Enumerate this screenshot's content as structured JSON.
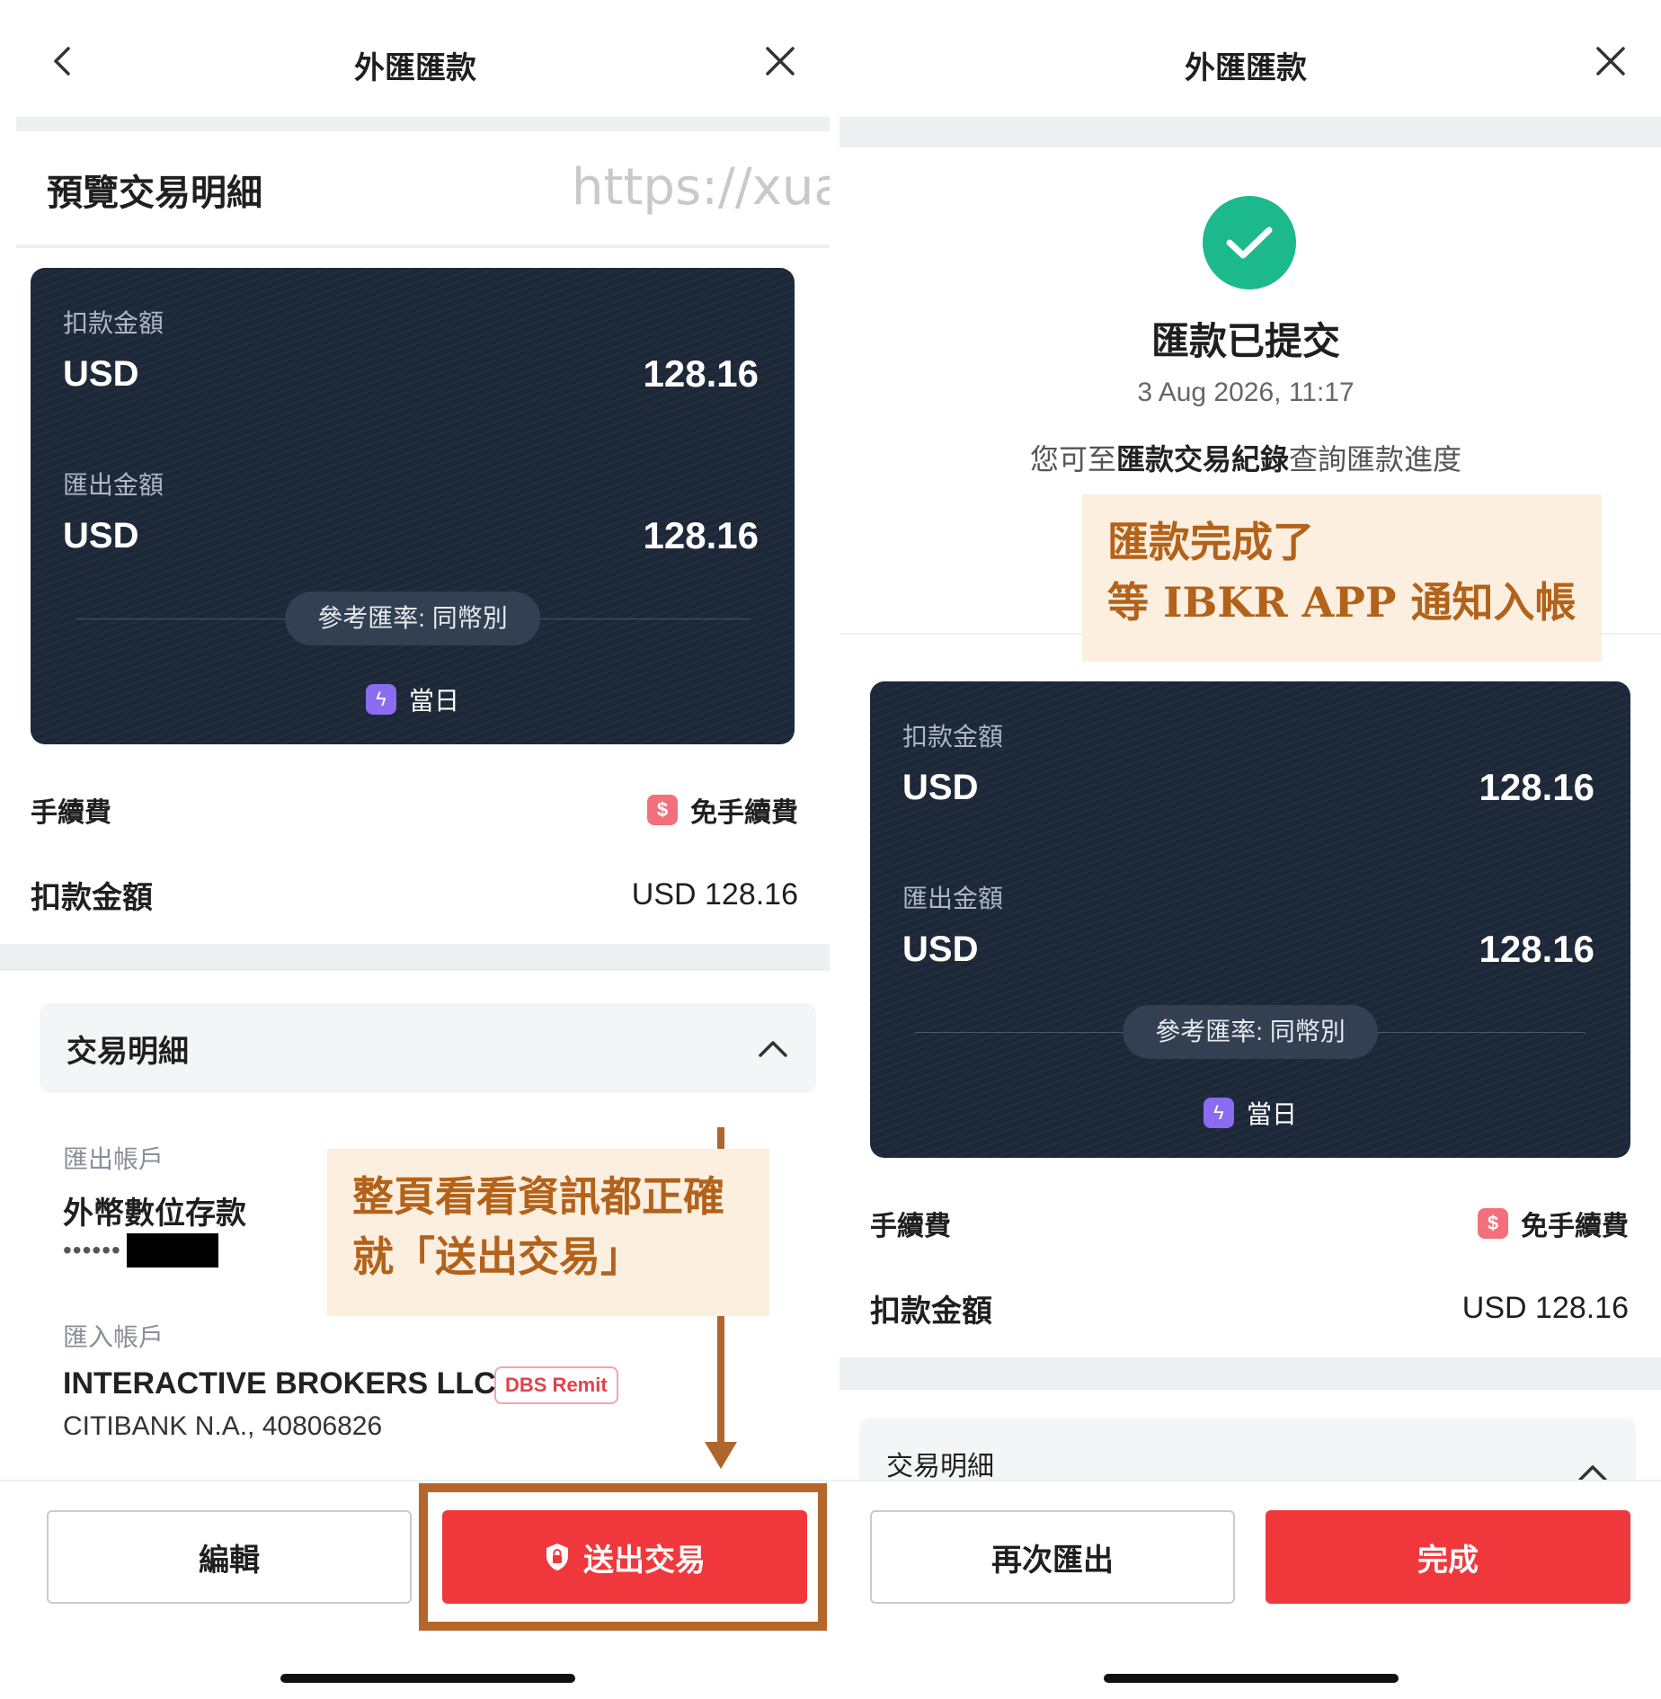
{
  "left": {
    "nav_title": "外匯匯款",
    "preview_title": "預覽交易明細",
    "watermark": "https://xuanstyl.com/",
    "card": {
      "debit_label": "扣款金額",
      "debit_currency": "USD",
      "debit_amount": "128.16",
      "remit_label": "匯出金額",
      "remit_currency": "USD",
      "remit_amount": "128.16",
      "rate_text": "參考匯率: 同幣別",
      "speed_icon": "lightning-icon",
      "speed_text": "當日"
    },
    "fee_label": "手續費",
    "fee_icon": "dollar-badge-icon",
    "fee_value": "免手續費",
    "debit_row_label": "扣款金額",
    "debit_row_value": "USD 128.16",
    "details_header": "交易明細",
    "from_label": "匯出帳戶",
    "from_name": "外幣數位存款",
    "from_masked": "••••••",
    "to_label": "匯入帳戶",
    "to_name": "INTERACTIVE BROKERS LLC",
    "to_tag": "DBS Remit",
    "to_bank": "CITIBANK N.A., 40806826",
    "note_line1": "整頁看看資訊都正確",
    "note_line2": "就「送出交易」",
    "edit_button": "編輯",
    "submit_button": "送出交易",
    "submit_icon": "lock-shield-icon"
  },
  "right": {
    "nav_title": "外匯匯款",
    "success_icon": "check-icon",
    "done_title": "匯款已提交",
    "done_time": "3 Aug 2026, 11:17",
    "hint_prefix": "您可至",
    "hint_link": "匯款交易紀錄",
    "hint_suffix": "查詢匯款進度",
    "note_line1": "匯款完成了",
    "note_line2": "等 IBKR APP 通知入帳",
    "card": {
      "debit_label": "扣款金額",
      "debit_currency": "USD",
      "debit_amount": "128.16",
      "remit_label": "匯出金額",
      "remit_currency": "USD",
      "remit_amount": "128.16",
      "rate_text": "參考匯率: 同幣別",
      "speed_text": "當日"
    },
    "fee_label": "手續費",
    "fee_value": "免手續費",
    "debit_row_label": "扣款金額",
    "debit_row_value": "USD 128.16",
    "details_header": "交易明細",
    "again_button": "再次匯出",
    "done_button": "完成"
  },
  "colors": {
    "card_bg": "#1c2838",
    "primary_red": "#f0383c",
    "success_green": "#1cb98c",
    "annotation_brown": "#b0652b",
    "annotation_bg": "#fcefe0"
  }
}
